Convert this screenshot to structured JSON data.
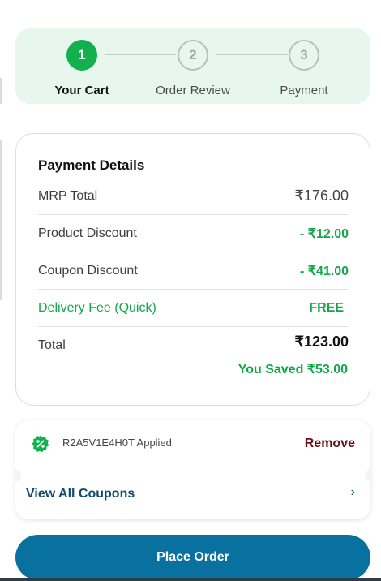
{
  "stepper": {
    "steps": [
      {
        "number": "1",
        "label": "Your Cart",
        "state": "active"
      },
      {
        "number": "2",
        "label": "Order Review",
        "state": "inactive"
      },
      {
        "number": "3",
        "label": "Payment",
        "state": "inactive"
      }
    ]
  },
  "payment": {
    "title": "Payment Details",
    "mrp_label": "MRP Total",
    "mrp_value": "₹176.00",
    "product_discount_label": "Product Discount",
    "product_discount_value": "- ₹12.00",
    "coupon_discount_label": "Coupon Discount",
    "coupon_discount_value": "- ₹41.00",
    "delivery_label": "Delivery Fee (Quick)",
    "delivery_value": "FREE",
    "total_label": "Total",
    "total_value": "₹123.00",
    "saved_text": "You Saved ₹53.00"
  },
  "coupon": {
    "applied_text": "R2A5V1E4H0T Applied",
    "remove_label": "Remove",
    "view_all_label": "View All Coupons",
    "chevron": "›",
    "icon": "discount-badge-icon"
  },
  "actions": {
    "place_order_label": "Place Order"
  },
  "colors": {
    "accent_green": "#12b04f",
    "primary_blue": "#08719f",
    "remove_maroon": "#6b0f1a",
    "stepper_bg": "#e7f7ee"
  }
}
